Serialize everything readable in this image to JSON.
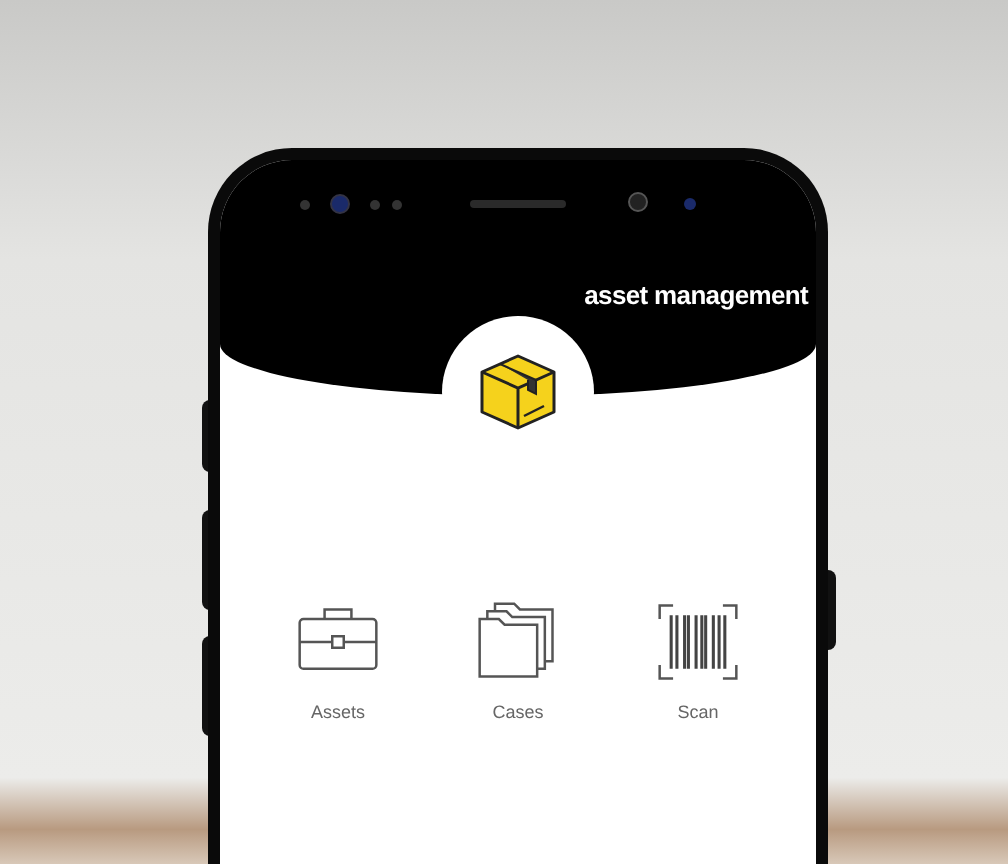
{
  "header": {
    "title": "asset management"
  },
  "menu": [
    {
      "label": "Assets",
      "kind": "briefcase"
    },
    {
      "label": "Cases",
      "kind": "folders"
    },
    {
      "label": "Scan",
      "kind": "barcode"
    }
  ]
}
